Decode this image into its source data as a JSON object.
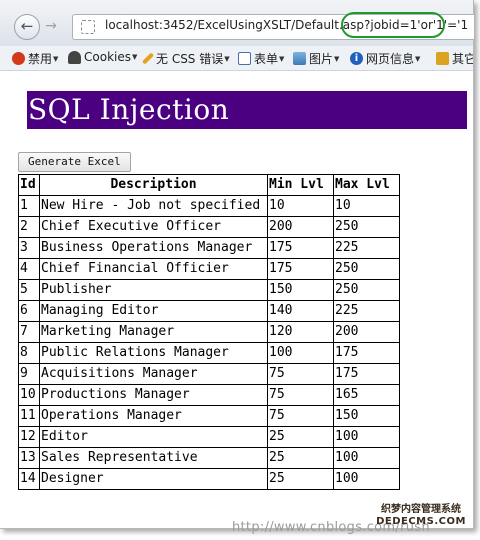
{
  "browser": {
    "url": "localhost:3452/ExcelUsingXSLT/Default.aspx?jobid=1'or'1'='1",
    "url_visible": "localhost:3452/ExcelUsingXSLT/Default.asp",
    "url_injected_part": "?jobid=1'or'1'='1",
    "back_icon": "←",
    "forward_icon": "→"
  },
  "bookmarks": [
    {
      "label": "禁用",
      "icon": "no-entry-icon",
      "color": "#d23a1a"
    },
    {
      "label": "Cookies",
      "icon": "person-icon",
      "color": "#333333"
    },
    {
      "label": "无 CSS 错误",
      "icon": "pencil-icon",
      "color": "#e4a11a"
    },
    {
      "label": "表单",
      "icon": "form-icon",
      "color": "#4a6fa5"
    },
    {
      "label": "图片",
      "icon": "image-icon",
      "color": "#3c7ab5"
    },
    {
      "label": "网页信息",
      "icon": "info-icon",
      "color": "#1f5fbf"
    },
    {
      "label": "其它",
      "icon": "folder-icon",
      "color": "#d9a520"
    }
  ],
  "page": {
    "title": "SQL Injection",
    "button_label": "Generate Excel",
    "title_bg": "#4b0082"
  },
  "table": {
    "headers": [
      "Id",
      "Description",
      "Min Lvl",
      "Max Lvl"
    ],
    "rows": [
      [
        "1",
        "New Hire - Job not specified",
        "10",
        "10"
      ],
      [
        "2",
        "Chief Executive Officer",
        "200",
        "250"
      ],
      [
        "3",
        "Business Operations Manager",
        "175",
        "225"
      ],
      [
        "4",
        "Chief Financial Officier",
        "175",
        "250"
      ],
      [
        "5",
        "Publisher",
        "150",
        "250"
      ],
      [
        "6",
        "Managing Editor",
        "140",
        "225"
      ],
      [
        "7",
        "Marketing Manager",
        "120",
        "200"
      ],
      [
        "8",
        "Public Relations Manager",
        "100",
        "175"
      ],
      [
        "9",
        "Acquisitions Manager",
        "75",
        "175"
      ],
      [
        "10",
        "Productions Manager",
        "75",
        "165"
      ],
      [
        "11",
        "Operations Manager",
        "75",
        "150"
      ],
      [
        "12",
        "Editor",
        "25",
        "100"
      ],
      [
        "13",
        "Sales Representative",
        "25",
        "100"
      ],
      [
        "14",
        "Designer",
        "25",
        "100"
      ]
    ]
  },
  "watermark": {
    "text": "http://www.cnblogs.com/rush",
    "logo_text": "织梦内容管理系统",
    "logo_site": "DEDECMS.COM"
  }
}
